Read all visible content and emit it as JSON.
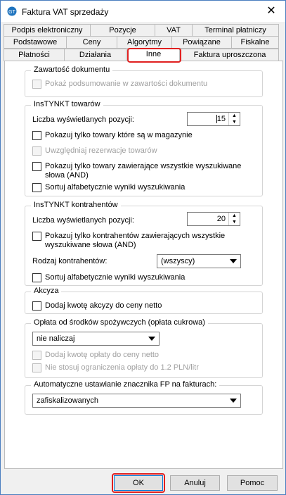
{
  "window": {
    "title": "Faktura VAT sprzedaży",
    "close_label": "✕"
  },
  "tabs": {
    "row1": [
      "Podpis elektroniczny",
      "Pozycje",
      "VAT",
      "Terminal płatniczy"
    ],
    "row2": [
      "Podstawowe",
      "Ceny",
      "Algorytmy",
      "Powiązane",
      "Fiskalne"
    ],
    "row3": [
      "Płatności",
      "Działania",
      "Inne",
      "Faktura uproszczona"
    ],
    "active": "Inne"
  },
  "zawartosc": {
    "title": "Zawartość dokumentu",
    "show_summary": "Pokaż podsumowanie w zawartości dokumentu"
  },
  "instynkt_towarow": {
    "title": "InsTYNKT towarów",
    "count_label": "Liczba wyświetlanych pozycji:",
    "count_value": "15",
    "only_in_stock": "Pokazuj tylko towary które są w magazynie",
    "reservations": "Uwzględniaj rezerwacje towarów",
    "all_words_line1": "Pokazuj tylko towary zawierające wszystkie wyszukiwane",
    "all_words_line2": "słowa (AND)",
    "sort_alpha": "Sortuj alfabetycznie wyniki wyszukiwania"
  },
  "instynkt_kontrahentow": {
    "title": "InsTYNKT kontrahentów",
    "count_label": "Liczba wyświetlanych pozycji:",
    "count_value": "20",
    "all_words_line1": "Pokazuj tylko kontrahentów zawierających wszystkie",
    "all_words_line2": "wyszukiwane słowa (AND)",
    "type_label": "Rodzaj kontrahentów:",
    "type_value": "(wszyscy)",
    "sort_alpha": "Sortuj alfabetycznie wyniki wyszukiwania"
  },
  "akcyza": {
    "title": "Akcyza",
    "add_to_net": "Dodaj kwotę akcyzy do ceny netto"
  },
  "oplata": {
    "title": "Opłata od środków spożywczych (opłata cukrowa)",
    "select_value": "nie naliczaj",
    "add_to_net": "Dodaj kwotę opłaty do ceny netto",
    "no_limit": "Nie stosuj ograniczenia opłaty do 1.2 PLN/litr"
  },
  "fp": {
    "title": "Automatyczne ustawianie znacznika FP na fakturach:",
    "select_value": "zafiskalizowanych"
  },
  "buttons": {
    "ok": "OK",
    "cancel": "Anuluj",
    "help": "Pomoc"
  },
  "colors": {
    "highlight": "#e02020",
    "accent": "#0078d7"
  }
}
